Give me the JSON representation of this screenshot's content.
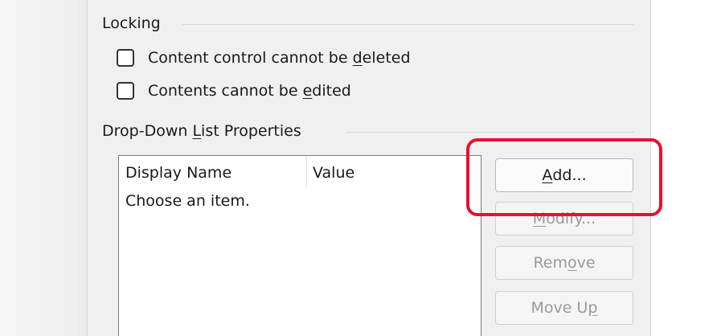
{
  "locking": {
    "title": "Locking",
    "options": [
      {
        "pre": "Content control cannot be ",
        "mnemonic": "d",
        "post": "eleted",
        "checked": false
      },
      {
        "pre": "Contents cannot be ",
        "mnemonic": "e",
        "post": "dited",
        "checked": false
      }
    ]
  },
  "dropdown": {
    "title_pre": "Drop-Down ",
    "title_mnemonic": "L",
    "title_post": "ist Properties",
    "columns": [
      "Display Name",
      "Value"
    ],
    "items": [
      {
        "display": "Choose an item.",
        "value": ""
      }
    ]
  },
  "buttons": {
    "add": {
      "pre": "",
      "mnemonic": "A",
      "post": "dd...",
      "enabled": true
    },
    "modify": {
      "pre": "",
      "mnemonic": "M",
      "post": "odify...",
      "enabled": false
    },
    "remove": {
      "pre": "Rem",
      "mnemonic": "o",
      "post": "ve",
      "enabled": false
    },
    "move_up": {
      "pre": "Move U",
      "mnemonic": "p",
      "post": "",
      "enabled": false
    }
  },
  "colors": {
    "highlight": "#e8102e",
    "dialog_bg": "#f0f0f0",
    "disabled_text": "#9a9a9a"
  }
}
